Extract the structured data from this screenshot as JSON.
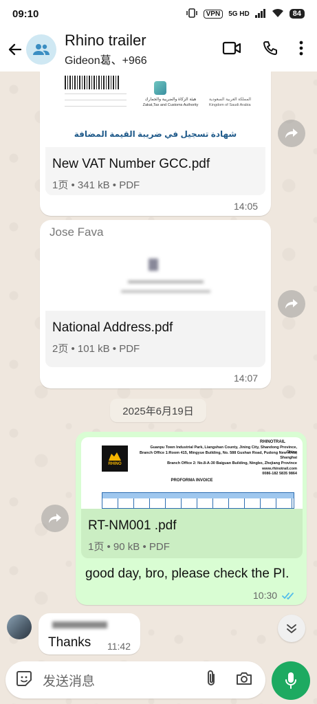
{
  "status_bar": {
    "time": "09:10",
    "vpn": "VPN",
    "network": "5G HD",
    "battery": "84"
  },
  "header": {
    "title": "Rhino trailer",
    "subtitle": "Gideon葛、+966"
  },
  "messages": [
    {
      "type": "document",
      "direction": "incoming",
      "preview_text": "شهادة تسجيل في ضريبة القيمة المضافة",
      "preview_org_en": "Zakat,Tax and Customs Authority",
      "preview_org_ar": "هيئة الزكاة والضريبة والجمارك",
      "preview_kingdom_en": "Kingdom of Saudi Arabia",
      "preview_kingdom_ar": "المملكة العربية السعودية",
      "name": "New VAT Number GCC.pdf",
      "meta": "1页 • 341 kB • PDF",
      "time": "14:05"
    },
    {
      "type": "document",
      "direction": "incoming",
      "sender": "Jose Fava",
      "name": "National Address.pdf",
      "meta": "2页 • 101 kB • PDF",
      "time": "14:07"
    },
    {
      "type": "date",
      "label": "2025年6月19日"
    },
    {
      "type": "document",
      "direction": "outgoing",
      "preview_company": "RHINOTRAIL",
      "preview_address": "Guanpu Town Industrial Park, Liangshan County, Jining City, Shandong Province, China",
      "preview_branch1": "Branch Office 1:Room 415, Mingyue Building, No. 588 Gushan Road, Pudong New Area, Shanghai",
      "preview_branch2": "Branch Office 2: No.8-A-30 Baiguan Building, Ningbo, Zhejiang Province",
      "preview_web": "www.rhinotrail.com",
      "preview_phone": "0086-182 5835 9864",
      "preview_doc_title": "PROFORMA INVOICE",
      "logo_text": "RHINO",
      "name": "RT-NM001 .pdf",
      "meta": "1页 • 90 kB • PDF",
      "caption": "good day, bro, please check the PI.",
      "time": "10:30"
    },
    {
      "type": "text",
      "direction": "incoming",
      "text": "Thanks",
      "time": "11:42"
    }
  ],
  "input": {
    "placeholder": "发送消息"
  },
  "colors": {
    "outgoing_bubble": "#d9fdd3",
    "mic_button": "#1daa61",
    "read_ticks": "#53bdeb"
  }
}
